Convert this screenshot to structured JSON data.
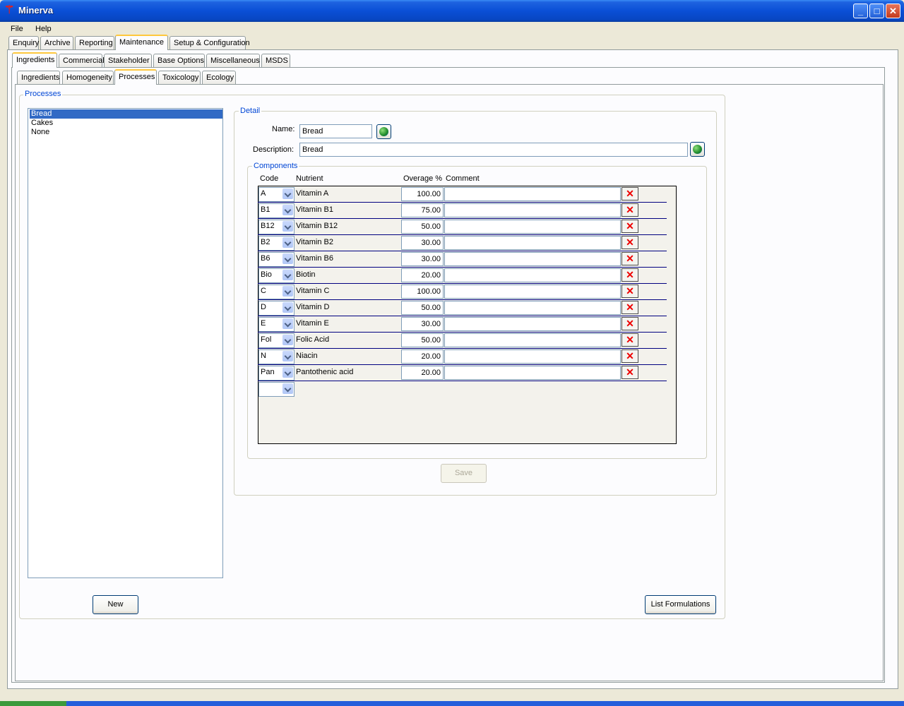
{
  "window": {
    "title": "Minerva",
    "minimize": "_",
    "maximize": "□",
    "close": "✕"
  },
  "menu": [
    "File",
    "Help"
  ],
  "main_tabs": [
    "Enquiry",
    "Archive",
    "Reporting",
    "Maintenance",
    "Setup & Configuration"
  ],
  "sub_tabs": [
    "Ingredients",
    "Commercial",
    "Stakeholder",
    "Base Options",
    "Miscellaneous",
    "MSDS"
  ],
  "inner_tabs": [
    "Ingredients",
    "Homogeneity",
    "Processes",
    "Toxicology",
    "Ecology"
  ],
  "processes": {
    "title": "Processes",
    "items": [
      "Bread",
      "Cakes",
      "None"
    ],
    "selected": "Bread",
    "new_button": "New",
    "list_button": "List Formulations"
  },
  "detail": {
    "title": "Detail",
    "name_label": "Name:",
    "name_value": "Bread",
    "description_label": "Description:",
    "description_value": "Bread",
    "save_button": "Save"
  },
  "components": {
    "title": "Components",
    "headers": [
      "Code",
      "Nutrient",
      "Overage %",
      "Comment"
    ],
    "rows": [
      {
        "code": "A",
        "nutrient": "Vitamin A",
        "overage": "100.00",
        "comment": ""
      },
      {
        "code": "B1",
        "nutrient": "Vitamin B1",
        "overage": "75.00",
        "comment": ""
      },
      {
        "code": "B12",
        "nutrient": "Vitamin B12",
        "overage": "50.00",
        "comment": ""
      },
      {
        "code": "B2",
        "nutrient": "Vitamin B2",
        "overage": "30.00",
        "comment": ""
      },
      {
        "code": "B6",
        "nutrient": "Vitamin B6",
        "overage": "30.00",
        "comment": ""
      },
      {
        "code": "Bio",
        "nutrient": "Biotin",
        "overage": "20.00",
        "comment": ""
      },
      {
        "code": "C",
        "nutrient": "Vitamin C",
        "overage": "100.00",
        "comment": ""
      },
      {
        "code": "D",
        "nutrient": "Vitamin D",
        "overage": "50.00",
        "comment": ""
      },
      {
        "code": "E",
        "nutrient": "Vitamin E",
        "overage": "30.00",
        "comment": ""
      },
      {
        "code": "Fol",
        "nutrient": "Folic Acid",
        "overage": "50.00",
        "comment": ""
      },
      {
        "code": "N",
        "nutrient": "Niacin",
        "overage": "20.00",
        "comment": ""
      },
      {
        "code": "Pan",
        "nutrient": "Pantothenic acid",
        "overage": "20.00",
        "comment": ""
      }
    ],
    "delete_glyph": "✕"
  }
}
